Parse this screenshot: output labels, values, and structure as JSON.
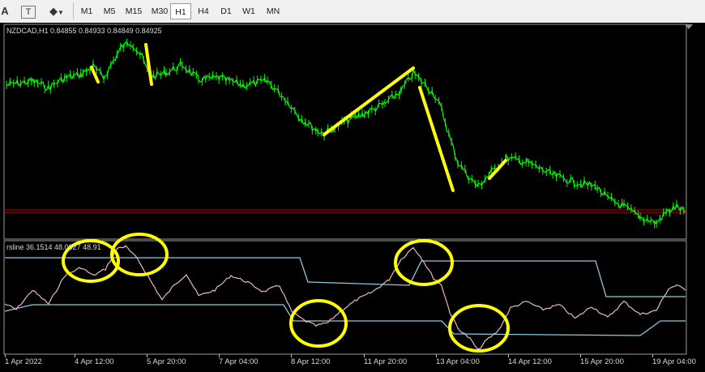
{
  "toolbar": {
    "text_tool": "A",
    "text_label_tool": "T",
    "objects_tool": "objects-icon",
    "timeframes": [
      {
        "label": "M1",
        "active": false
      },
      {
        "label": "M5",
        "active": false
      },
      {
        "label": "M15",
        "active": false
      },
      {
        "label": "M30",
        "active": false
      },
      {
        "label": "H1",
        "active": true
      },
      {
        "label": "H4",
        "active": false
      },
      {
        "label": "D1",
        "active": false
      },
      {
        "label": "W1",
        "active": false
      },
      {
        "label": "MN",
        "active": false
      }
    ]
  },
  "main_chart": {
    "title": "NZDCAD,H1  0.84855 0.84933 0.84849 0.84925",
    "candle_color": "#00ff00",
    "trendline_color": "#ffff00",
    "price_line_color": "#cc0000"
  },
  "indicator": {
    "title": "rsline 36.1514 48.0027 48.91",
    "rsi_color": "#e8b8c0",
    "band_color": "#8ec9e0",
    "circle_color": "#ffff00"
  },
  "x_axis": {
    "labels": [
      "1 Apr 2022",
      "4 Apr 12:00",
      "5 Apr 20:00",
      "7 Apr 04:00",
      "8 Apr 12:00",
      "11 Apr 20:00",
      "13 Apr 04:00",
      "14 Apr 12:00",
      "15 Apr 20:00",
      "19 Apr 04:00"
    ]
  }
}
